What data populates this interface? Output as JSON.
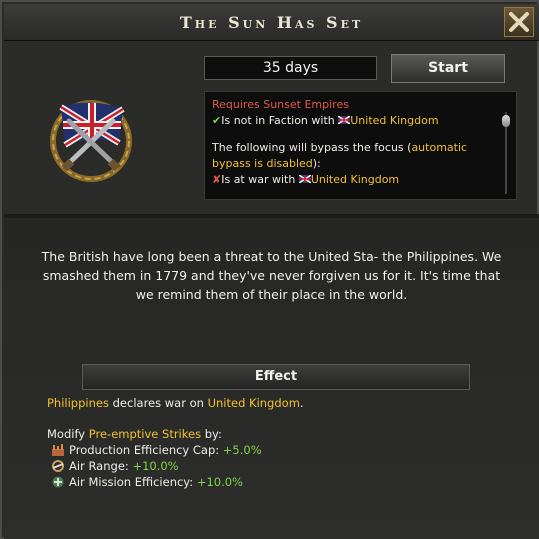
{
  "window": {
    "title": "The Sun Has Set"
  },
  "controls": {
    "days": "35 days",
    "start_label": "Start"
  },
  "requirements": {
    "requires_prefix": "Requires",
    "requires_focus": "Sunset Empires",
    "cond1_text": "Is not in Faction with",
    "cond1_country": "United Kingdom",
    "bypass_prefix": "The following will bypass the focus (",
    "bypass_highlight": "automatic bypass is disabled",
    "bypass_suffix": "):",
    "cond2_text": "Is at war with",
    "cond2_country": "United Kingdom"
  },
  "description": "The British have long been a threat to the United Sta- the Philippines. We smashed them in 1779 and they've never forgiven us for it. It's time that we remind them of their place in the world.",
  "effect": {
    "header": "Effect",
    "actor": "Philippines",
    "action": "declares war on",
    "target": "United Kingdom",
    "period": ".",
    "modify_prefix": "Modify",
    "modify_name": "Pre-emptive Strikes",
    "modify_suffix": "by:",
    "modifiers": [
      {
        "label": "Production Efficiency Cap:",
        "value": "+5.0%",
        "icon": "factory-icon"
      },
      {
        "label": "Air Range:",
        "value": "+10.0%",
        "icon": "air-range-icon"
      },
      {
        "label": "Air Mission Efficiency:",
        "value": "+10.0%",
        "icon": "air-efficiency-icon"
      }
    ]
  },
  "colors": {
    "requirement_red": "#e05a4a",
    "highlight_yellow": "#f2c12e",
    "positive_green": "#7fd64a"
  }
}
